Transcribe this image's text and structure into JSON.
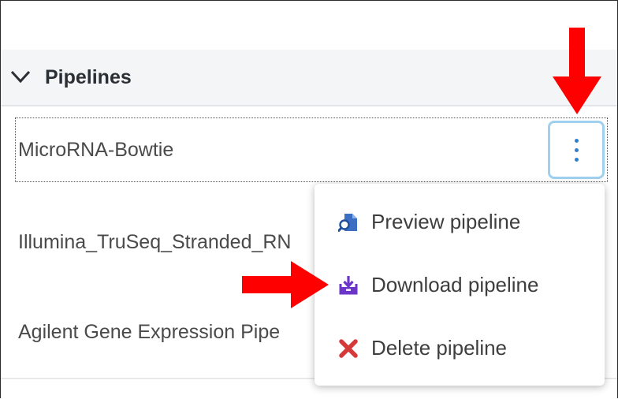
{
  "section": {
    "title": "Pipelines"
  },
  "pipelines": [
    {
      "label": "MicroRNA-Bowtie"
    },
    {
      "label": "Illumina_TruSeq_Stranded_RN"
    },
    {
      "label": "Agilent Gene Expression Pipe"
    }
  ],
  "context_menu": {
    "items": [
      {
        "label": "Preview pipeline",
        "icon": "preview-icon",
        "color": "#3b6fc4"
      },
      {
        "label": "Download pipeline",
        "icon": "download-icon",
        "color": "#6a35c8"
      },
      {
        "label": "Delete pipeline",
        "icon": "delete-x-icon",
        "color": "#d53a3a"
      }
    ]
  },
  "colors": {
    "annotation_arrow": "#ff0000",
    "kebab_dots": "#2f7fd1",
    "kebab_focus_ring": "#9fd0ee"
  }
}
